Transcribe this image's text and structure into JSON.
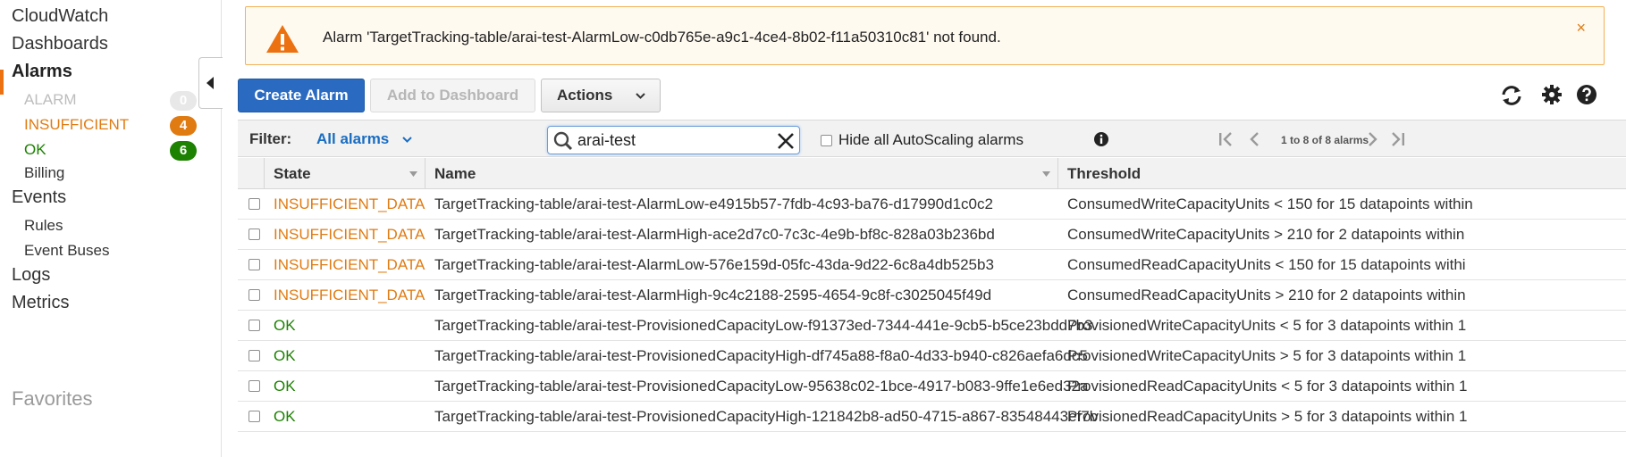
{
  "sidebar": {
    "cloudwatch": "CloudWatch",
    "dashboards": "Dashboards",
    "alarms": "Alarms",
    "alarm_states": [
      {
        "label": "ALARM",
        "count": "0"
      },
      {
        "label": "INSUFFICIENT",
        "count": "4"
      },
      {
        "label": "OK",
        "count": "6"
      }
    ],
    "billing": "Billing",
    "events": "Events",
    "rules": "Rules",
    "event_buses": "Event Buses",
    "logs": "Logs",
    "metrics": "Metrics",
    "favorites": "Favorites"
  },
  "banner": {
    "message": "Alarm 'TargetTracking-table/arai-test-AlarmLow-c0db765e-a9c1-4ce4-8b02-f11a50310c81' not found.",
    "close": "×"
  },
  "toolbar": {
    "create_alarm": "Create Alarm",
    "add_to_dashboard": "Add to Dashboard",
    "actions": "Actions"
  },
  "filter": {
    "label": "Filter:",
    "selected": "All alarms",
    "search_value": "arai-test",
    "hide_autoscaling": "Hide all AutoScaling alarms",
    "pagination": "1 to 8 of 8 alarms"
  },
  "table": {
    "columns": {
      "state": "State",
      "name": "Name",
      "threshold": "Threshold"
    },
    "rows": [
      {
        "state": "INSUFFICIENT_DATA",
        "name": "TargetTracking-table/arai-test-AlarmLow-e4915b57-7fdb-4c93-ba76-d17990d1c0c2",
        "threshold": "ConsumedWriteCapacityUnits < 150 for 15 datapoints within"
      },
      {
        "state": "INSUFFICIENT_DATA",
        "name": "TargetTracking-table/arai-test-AlarmHigh-ace2d7c0-7c3c-4e9b-bf8c-828a03b236bd",
        "threshold": "ConsumedWriteCapacityUnits > 210 for 2 datapoints within"
      },
      {
        "state": "INSUFFICIENT_DATA",
        "name": "TargetTracking-table/arai-test-AlarmLow-576e159d-05fc-43da-9d22-6c8a4db525b3",
        "threshold": "ConsumedReadCapacityUnits < 150 for 15 datapoints withi"
      },
      {
        "state": "INSUFFICIENT_DATA",
        "name": "TargetTracking-table/arai-test-AlarmHigh-9c4c2188-2595-4654-9c8f-c3025045f49d",
        "threshold": "ConsumedReadCapacityUnits > 210 for 2 datapoints within"
      },
      {
        "state": "OK",
        "name": "TargetTracking-table/arai-test-ProvisionedCapacityLow-f91373ed-7344-441e-9cb5-b5ce23bdd7b3",
        "threshold": "ProvisionedWriteCapacityUnits < 5 for 3 datapoints within 1"
      },
      {
        "state": "OK",
        "name": "TargetTracking-table/arai-test-ProvisionedCapacityHigh-df745a88-f8a0-4d33-b940-c826aefa6dc5",
        "threshold": "ProvisionedWriteCapacityUnits > 5 for 3 datapoints within 1"
      },
      {
        "state": "OK",
        "name": "TargetTracking-table/arai-test-ProvisionedCapacityLow-95638c02-1bce-4917-b083-9ffe1e6ed32a",
        "threshold": "ProvisionedReadCapacityUnits < 5 for 3 datapoints within 1"
      },
      {
        "state": "OK",
        "name": "TargetTracking-table/arai-test-ProvisionedCapacityHigh-121842b8-ad50-4715-a867-83548443ef7b",
        "threshold": "ProvisionedReadCapacityUnits > 5 for 3 datapoints within 1"
      }
    ]
  },
  "colors": {
    "insufficient": "#e07b12",
    "ok": "#1d8102",
    "primary": "#2a6bc1",
    "link": "#1a6dc2",
    "banner_border": "#f3b25b"
  },
  "icons": {
    "warning": "warning-icon",
    "refresh": "refresh-icon",
    "settings": "gear-icon",
    "help": "help-icon",
    "search": "search-icon",
    "clear": "clear-icon",
    "info": "info-icon"
  }
}
